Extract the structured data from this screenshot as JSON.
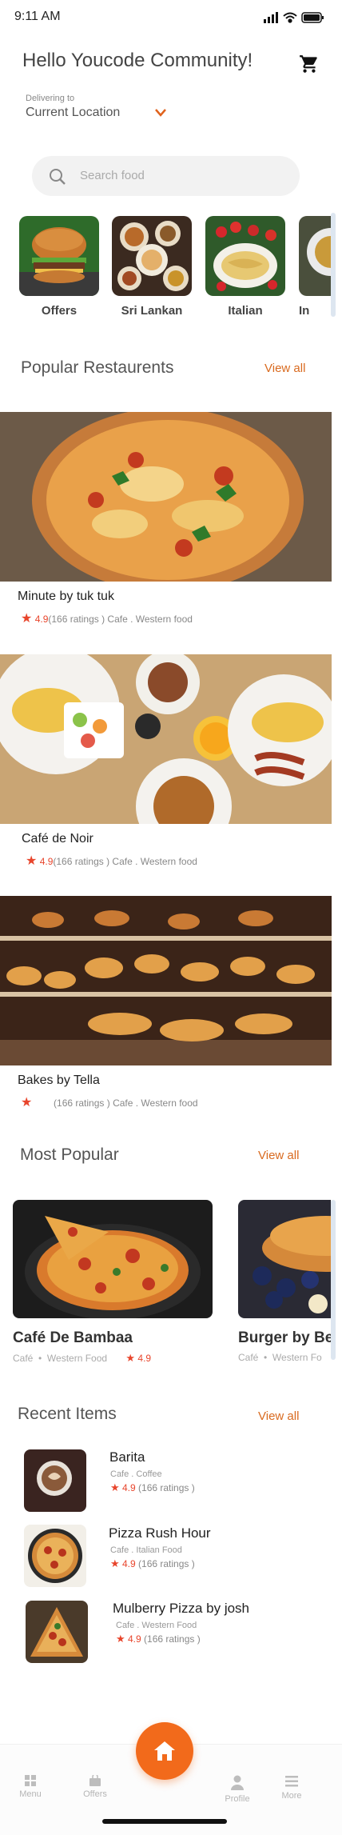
{
  "status": {
    "time": "9:11 AM"
  },
  "header": {
    "greeting": "Hello Youcode Community!",
    "delivering_label": "Delivering to",
    "location": "Current Location"
  },
  "search": {
    "placeholder": "Search food"
  },
  "categories": [
    {
      "label": "Offers",
      "icon": "burger-image"
    },
    {
      "label": "Sri Lankan",
      "icon": "rice-dishes-image"
    },
    {
      "label": "Italian",
      "icon": "pasta-image"
    },
    {
      "label": "In",
      "icon": "indian-food-image"
    }
  ],
  "popular_restaurants": {
    "title": "Popular Restaurents",
    "view_all": "View all",
    "items": [
      {
        "name": "Minute by tuk tuk",
        "rating": "4.9",
        "ratings_count": "(166 ratings )",
        "meta": "Cafe . Western food"
      },
      {
        "name": "Café de Noir",
        "rating": "4.9",
        "ratings_count": "(166 ratings )",
        "meta": "Cafe . Western food"
      },
      {
        "name": "Bakes by Tella",
        "rating": "",
        "ratings_count": "(166 ratings )",
        "meta": "Cafe . Western food"
      }
    ]
  },
  "most_popular": {
    "title": "Most Popular",
    "view_all": "View all",
    "items": [
      {
        "name": "Café De Bambaa",
        "type": "Café",
        "food": "Western Food",
        "rating": "4.9"
      },
      {
        "name": "Burger by Be",
        "type": "Café",
        "food": "Western Fo",
        "rating": ""
      }
    ]
  },
  "recent_items": {
    "title": "Recent Items",
    "view_all": "View all",
    "items": [
      {
        "name": "Barita",
        "sub": "Cafe . Coffee",
        "rating": "4.9",
        "ratings_count": "(166 ratings )"
      },
      {
        "name": "Pizza Rush Hour",
        "sub": "Cafe . Italian Food",
        "rating": "4.9",
        "ratings_count": "(166 ratings )"
      },
      {
        "name": "Mulberry Pizza by josh",
        "sub": "Cafe . Western Food",
        "rating": "4.9",
        "ratings_count": "(166 ratings )"
      }
    ]
  },
  "nav": {
    "menu": "Menu",
    "offers": "Offers",
    "profile": "Profile",
    "more": "More"
  },
  "colors": {
    "accent": "#f26a1b",
    "star": "#e8452c",
    "link": "#d96a1f"
  }
}
